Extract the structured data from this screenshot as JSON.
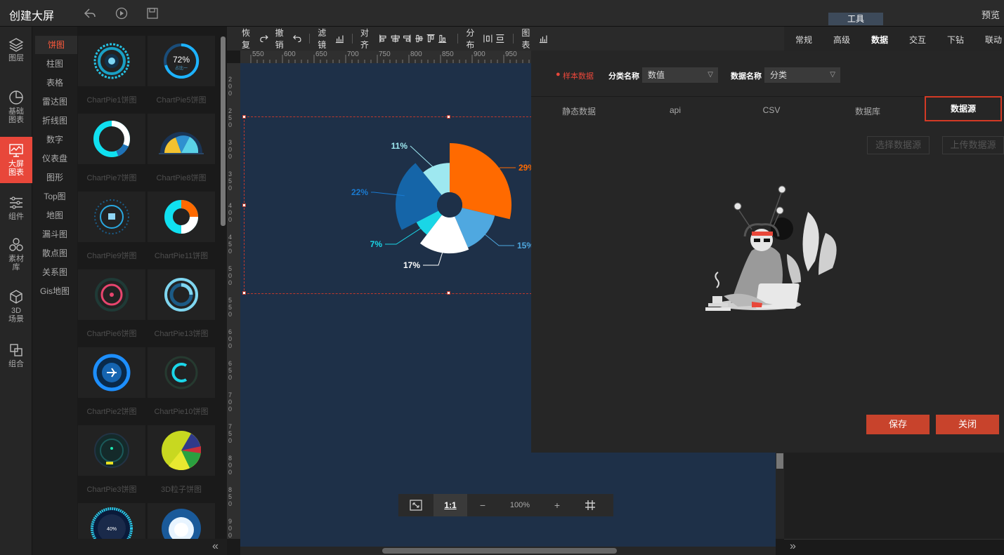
{
  "app": {
    "title": "创建大屏",
    "preview": "预览",
    "tools_tab": "工具"
  },
  "leftnav": [
    {
      "label": "图层",
      "icon": "layers-icon"
    },
    {
      "label": "基础\n图表",
      "icon": "pie-chart-icon"
    },
    {
      "label": "大屏\n图表",
      "icon": "screen-chart-icon"
    },
    {
      "label": "组件",
      "icon": "sliders-icon"
    },
    {
      "label": "素材\n库",
      "icon": "material-icon"
    },
    {
      "label": "3D\n场景",
      "icon": "cube-icon"
    },
    {
      "label": "组合",
      "icon": "group-icon"
    }
  ],
  "subnav": [
    "饼图",
    "柱图",
    "表格",
    "雷达图",
    "折线图",
    "数字",
    "仪表盘",
    "图形",
    "Top图",
    "地图",
    "漏斗图",
    "散点图",
    "关系图",
    "Gis地图"
  ],
  "gallery": [
    "ChartPie1饼图",
    "ChartPie5饼图",
    "ChartPie7饼图",
    "ChartPie8饼图",
    "ChartPie9饼图",
    "ChartPie11饼图",
    "ChartPie6饼图",
    "ChartPie13饼图",
    "ChartPie2饼图",
    "ChartPie10饼图",
    "ChartPie3饼图",
    "3D粒子饼图",
    "",
    ""
  ],
  "gallery_texts": {
    "pie5_value": "72%",
    "pie5_sub": "占比一",
    "pie_last_value": "40%"
  },
  "toolbar": {
    "redo": "恢复",
    "undo": "撤销",
    "filter": "滤镜",
    "align": "对齐",
    "distribute": "分布",
    "chart": "图表"
  },
  "hruler_ticks": [
    "550",
    "600",
    "650",
    "700",
    "750",
    "800",
    "850",
    "900",
    "950"
  ],
  "vruler_ticks": [
    "200",
    "250",
    "300",
    "350",
    "400",
    "450",
    "500",
    "550",
    "600",
    "650",
    "700",
    "750",
    "800",
    "850",
    "900"
  ],
  "zoom": {
    "fit": "1:1",
    "level": "100%",
    "minus": "−",
    "plus": "+"
  },
  "right_tabs": [
    "常规",
    "高级",
    "数据",
    "交互",
    "下钻",
    "联动"
  ],
  "dialog": {
    "sample_data": "样本数据",
    "category_label": "分类名称",
    "category_value": "数值",
    "data_name_label": "数据名称",
    "data_name_value": "分类",
    "tabs": [
      "静态数据",
      "api",
      "CSV",
      "数据库",
      "数据源"
    ],
    "select_source": "选择数据源",
    "upload_source": "上传数据源",
    "save": "保存",
    "close": "关闭"
  },
  "chart_data": {
    "type": "pie",
    "subtype": "rose",
    "slices": [
      {
        "label": "29%",
        "value": 29,
        "color": "#ff6a00"
      },
      {
        "label": "15%",
        "value": 15,
        "color": "#4fa8e0"
      },
      {
        "label": "17%",
        "value": 17,
        "color": "#ffffff"
      },
      {
        "label": "7%",
        "value": 7,
        "color": "#1ad6e6"
      },
      {
        "label": "22%",
        "value": 22,
        "color": "#1565a8"
      },
      {
        "label": "11%",
        "value": 11,
        "color": "#9ee8f0"
      }
    ]
  },
  "colors": {
    "accent": "#e8473a",
    "canvas": "#1e3048",
    "button": "#c8432c"
  }
}
